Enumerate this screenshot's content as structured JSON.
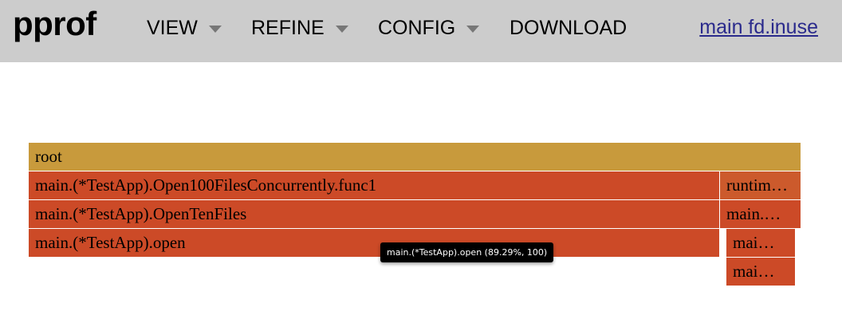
{
  "app": {
    "logo": "pprof",
    "title_link": "main fd.inuse"
  },
  "menu": {
    "view": "VIEW",
    "refine": "REFINE",
    "config": "CONFIG",
    "download": "DOWNLOAD"
  },
  "flamegraph": {
    "frames": {
      "root": "root",
      "open100": "main.(*TestApp).Open100FilesConcurrently.func1",
      "runtime": "runtim…",
      "openten": "main.(*TestApp).OpenTenFiles",
      "main_a": "main.…",
      "open": "main.(*TestApp).open",
      "mai_b": "mai…",
      "mai_c": "mai…"
    },
    "tooltip": "main.(*TestApp).open (89.29%, 100)"
  },
  "colors": {
    "header_bg": "#cccccc",
    "root_frame": "#c89a3c",
    "hot_frame": "#cc4a27",
    "link": "#2a2a8c"
  }
}
